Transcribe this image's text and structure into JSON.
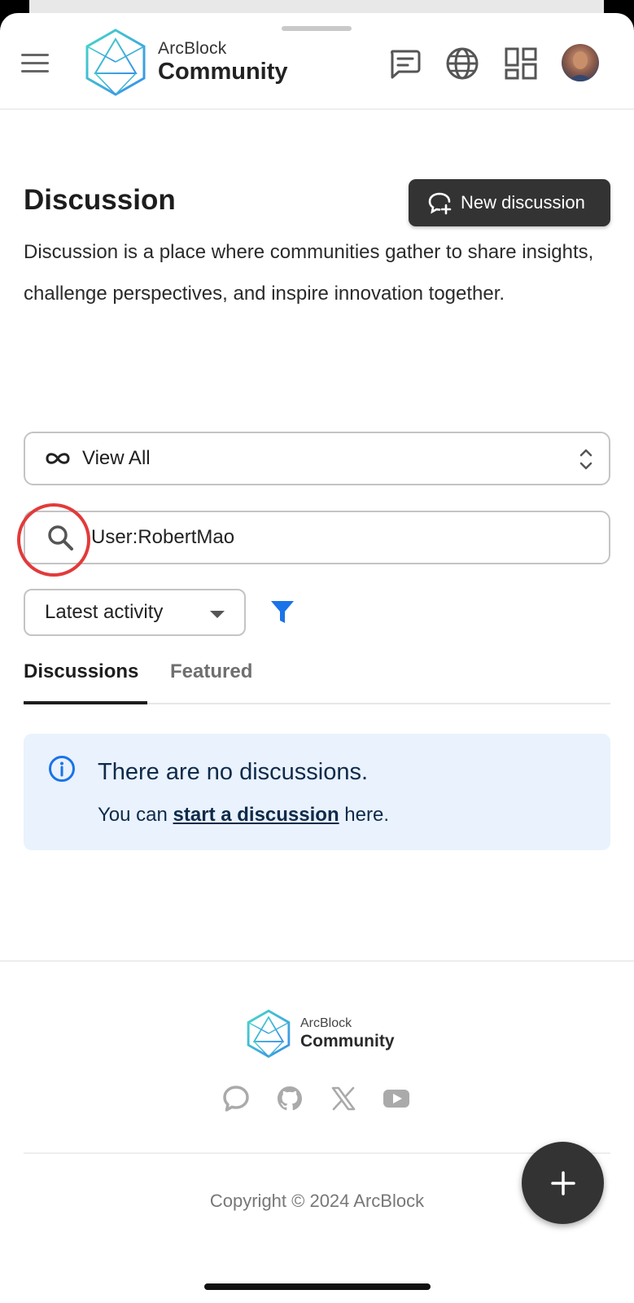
{
  "header": {
    "logo_small": "ArcBlock",
    "logo_big": "Community",
    "icons": [
      "menu-icon",
      "chat-icon",
      "globe-icon",
      "grid-icon",
      "avatar"
    ]
  },
  "page": {
    "title": "Discussion",
    "new_button_label": "New discussion",
    "description": "Discussion is a place where communities gather to share insights, challenge perspectives, and inspire innovation together."
  },
  "filters": {
    "view_label": "View All",
    "search_value": "User:RobertMao",
    "sort_label": "Latest activity",
    "filter_color": "#1a73e8"
  },
  "tabs": [
    {
      "label": "Discussions",
      "active": true
    },
    {
      "label": "Featured",
      "active": false
    }
  ],
  "empty_state": {
    "title": "There are no discussions.",
    "body_prefix": "You can",
    "link_text": "start a discussion",
    "body_suffix": "here."
  },
  "footer": {
    "logo_small": "ArcBlock",
    "logo_big": "Community",
    "social": [
      "chat-bubble-icon",
      "github-icon",
      "x-icon",
      "youtube-icon"
    ],
    "copyright": "Copyright © 2024 ArcBlock"
  },
  "colors": {
    "accent": "#1a73e8",
    "highlight_ring": "#e23a3a",
    "info_bg": "#e9f2fd",
    "dark_button": "#333333",
    "logo_cyan": "#3ec6e0"
  }
}
